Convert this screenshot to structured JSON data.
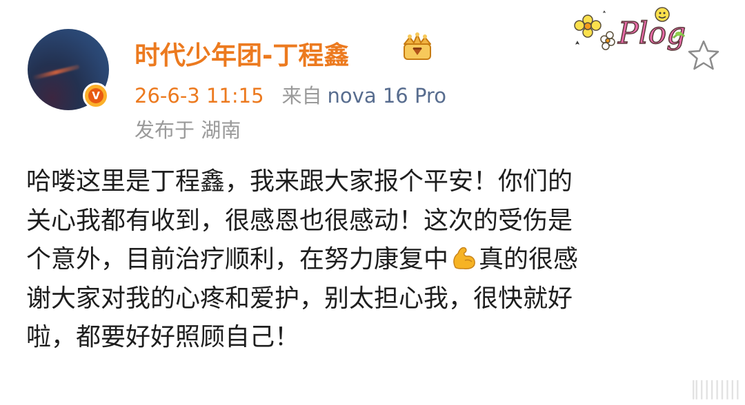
{
  "post": {
    "username": "时代少年团-丁程鑫",
    "time": "26-6-3 11:15",
    "from_label": "来自",
    "device": "nova 16 Pro",
    "location": "发布于 湖南",
    "body": {
      "line1": "哈喽这里是丁程鑫，我来跟大家报个平安！你们的",
      "line2": "关心我都有收到，很感恩也很感动！这次的受伤是",
      "line3_before": "个意外，目前治疗顺利，在努力康复中",
      "line3_after": "真的很感",
      "line4": "谢大家对我的心疼和爱护，别太担心我，很快就好",
      "line5": "啦，都要好好照顾自己！"
    }
  },
  "badge": {
    "verified_letter": "V"
  },
  "icons": {
    "avatar": "avatar-image",
    "verified": "verified-badge-icon",
    "vip": "vip-crown-icon",
    "plog": "plog-sticker-icon",
    "favorite": "star-icon",
    "emoji": "flexed-biceps-emoji"
  },
  "colors": {
    "username": "#ec7a1f",
    "time": "#ec7a1f",
    "device": "#586d8f",
    "meta_gray": "#9a9a9a",
    "body_text": "#1e1e1e"
  },
  "watermark": "‖||||||||"
}
